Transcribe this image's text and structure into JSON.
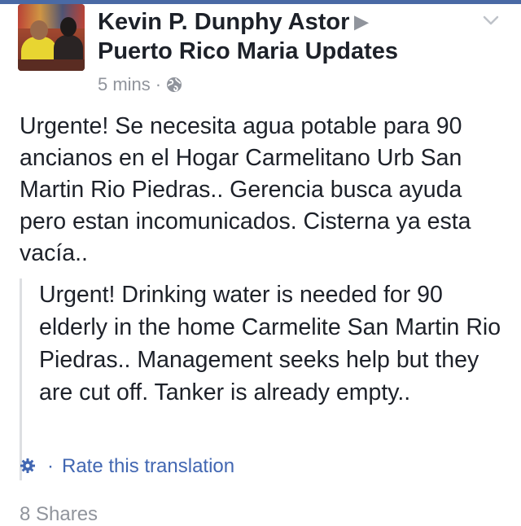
{
  "post": {
    "author": "Kevin P. Dunphy Astor",
    "group": "Puerto Rico Maria Updates",
    "timestamp": "5 mins",
    "meta_separator": "·",
    "original_text": "Urgente! Se necesita agua potable para 90 ancianos en el Hogar Carmelitano Urb San Martin Rio Piedras.. Gerencia busca ayuda pero estan incomunicados. Cisterna ya esta vacía..",
    "translation_text": "Urgent! Drinking water is needed for 90 elderly in the home Carmelite San Martin Rio Piedras.. Management seeks help but they are cut off. Tanker is already empty..",
    "rate_separator": "·",
    "rate_label": "Rate this translation",
    "shares_label": "8 Shares"
  },
  "icons": {
    "arrow": "right-triangle-icon",
    "chevron": "chevron-down-icon",
    "globe": "globe-icon",
    "gear": "gear-icon"
  },
  "colors": {
    "link": "#4267b2",
    "muted": "#90949c",
    "text": "#1d2129",
    "quote_border": "#dddfe2"
  }
}
